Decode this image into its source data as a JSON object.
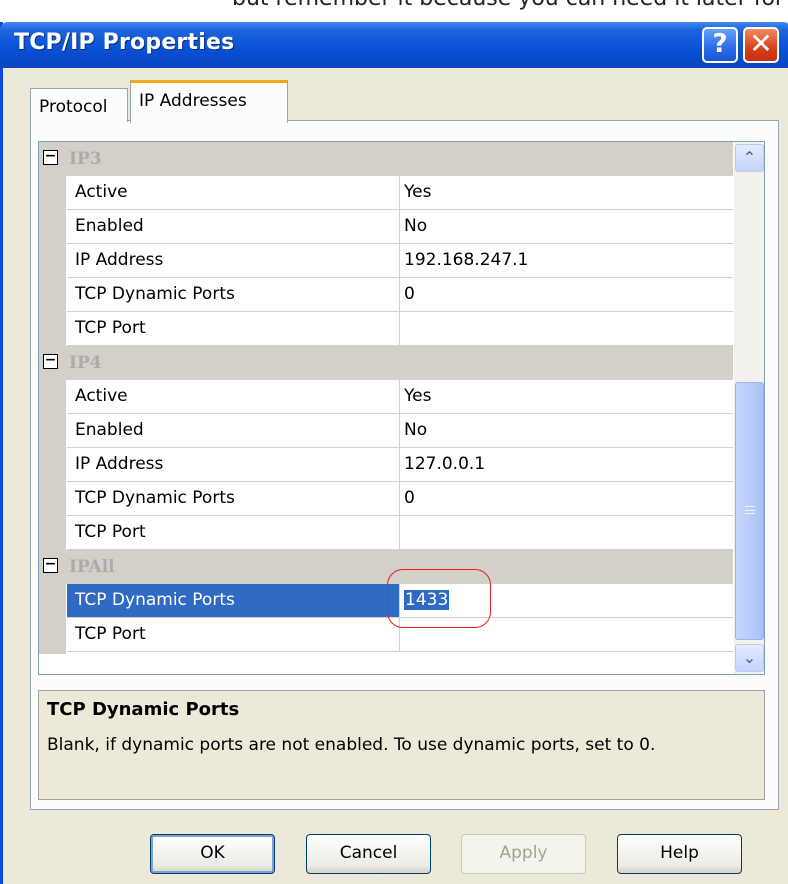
{
  "background_text": "but remember it because you can need it later for sman",
  "window": {
    "title": "TCP/IP Properties",
    "help_glyph": "?",
    "close_glyph": "✕"
  },
  "tabs": [
    {
      "label": "Protocol",
      "active": false
    },
    {
      "label": "IP Addresses",
      "active": true
    }
  ],
  "grid": {
    "categories": [
      {
        "name": "IP3",
        "toggle": "⊟",
        "rows": [
          {
            "name": "Active",
            "value": "Yes"
          },
          {
            "name": "Enabled",
            "value": "No"
          },
          {
            "name": "IP Address",
            "value": "192.168.247.1"
          },
          {
            "name": "TCP Dynamic Ports",
            "value": "0"
          },
          {
            "name": "TCP Port",
            "value": ""
          }
        ]
      },
      {
        "name": "IP4",
        "toggle": "⊟",
        "rows": [
          {
            "name": "Active",
            "value": "Yes"
          },
          {
            "name": "Enabled",
            "value": "No"
          },
          {
            "name": "IP Address",
            "value": "127.0.0.1"
          },
          {
            "name": "TCP Dynamic Ports",
            "value": "0"
          },
          {
            "name": "TCP Port",
            "value": ""
          }
        ]
      },
      {
        "name": "IPAll",
        "toggle": "⊟",
        "rows": [
          {
            "name": "TCP Dynamic Ports",
            "value": "1433",
            "selected": true
          },
          {
            "name": "TCP Port",
            "value": ""
          }
        ]
      }
    ],
    "scroll_up_glyph": "⌃",
    "scroll_down_glyph": "⌄"
  },
  "description": {
    "title": "TCP Dynamic Ports",
    "text": "Blank, if dynamic ports are not enabled. To use dynamic ports, set to 0."
  },
  "buttons": {
    "ok": "OK",
    "cancel": "Cancel",
    "apply": "Apply",
    "help": "Help"
  },
  "colors": {
    "titlebar": "#0a52d8",
    "selection": "#316ac5",
    "annotation": "#e02020",
    "category_bg": "#d4d0c8"
  }
}
